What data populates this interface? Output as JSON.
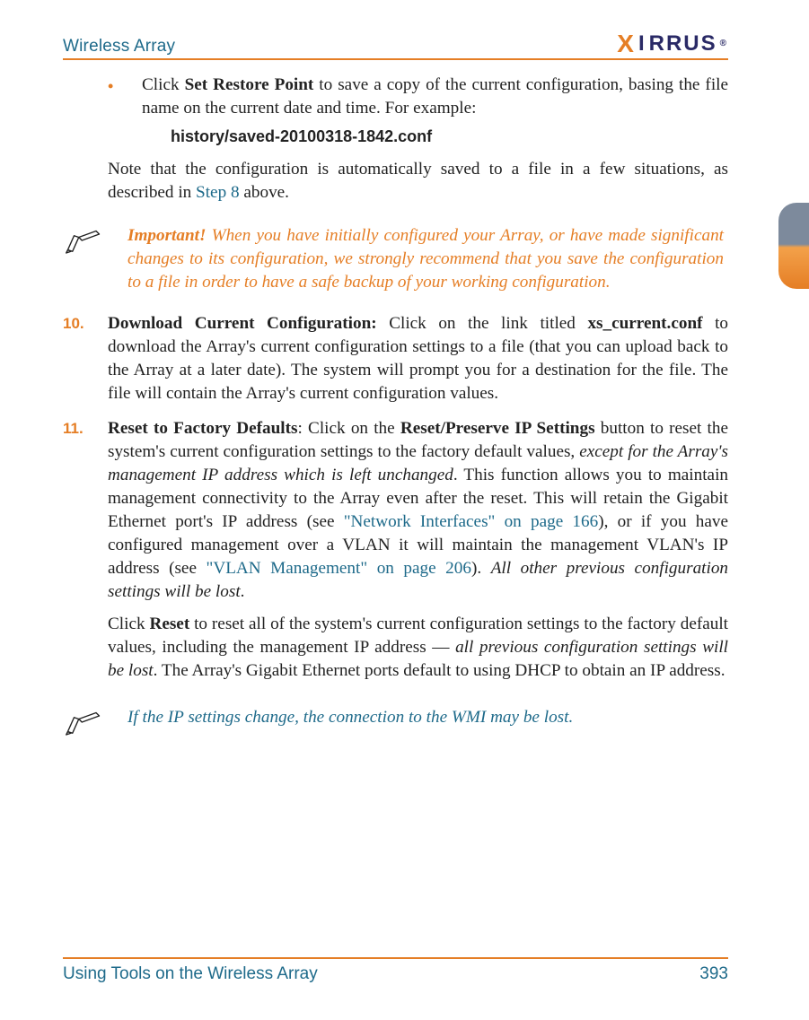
{
  "header": {
    "title": "Wireless Array",
    "logo_left": "X",
    "logo_mid": "I",
    "logo_right": "RRUS",
    "logo_mark": "®"
  },
  "content": {
    "bullet": {
      "lead_a": "Click ",
      "bold_a": "Set Restore Point",
      "tail_a": " to save a copy of the current configuration, basing the file name on the current date and time. For example:"
    },
    "example_filename": "history/saved-20100318-1842.conf",
    "note": {
      "a": "Note that the configuration is automatically saved to a file in a few situations, as described in ",
      "link": "Step 8",
      "b": " above."
    },
    "callout1": {
      "lead": "Important!",
      "body": " When you have initially configured your Array, or have made significant changes to its configuration, we strongly recommend that you save the configuration to a file in order to have a safe backup of your working configuration."
    },
    "item10": {
      "num": "10.",
      "title": "Download Current Configuration:",
      "a": " Click on the link titled ",
      "bold_a": "xs_current.conf",
      "b": " to download the Array's current configuration settings to a file (that you can upload back to the Array at a later date). The system will prompt you for a destination for the file. The file will contain the Array's current configuration values."
    },
    "item11": {
      "num": "11.",
      "title": "Reset to Factory Defaults",
      "a": ": Click on the ",
      "bold_a": "Reset/Preserve IP Settings",
      "b": " button to reset the system's current configuration settings to the factory default values, ",
      "italic_a": "except for the Array's management IP address which is left unchanged",
      "c": ". This function allows you to maintain management connectivity to the Array even after the reset. This will retain the Gigabit Ethernet port's IP address (see ",
      "link_a": "\"Network Interfaces\" on page 166",
      "d": "), or if you have configured management over a VLAN it will maintain the management VLAN's IP address (see ",
      "link_b": "\"VLAN Management\" on page 206",
      "e": "). ",
      "italic_b": "All other previous configuration settings will be lost",
      "f": ".",
      "p2_a": "Click ",
      "p2_bold": "Reset",
      "p2_b": " to reset all of the system's current configuration settings to the factory default values, including the management IP address — ",
      "p2_italic": "all previous configuration settings will be lost",
      "p2_c": ". The Array's Gigabit Ethernet ports default to using DHCP to obtain an IP address."
    },
    "callout2": {
      "body": "If the IP settings change, the connection to the WMI may be lost."
    }
  },
  "footer": {
    "left": "Using Tools on the Wireless Array",
    "right": "393"
  }
}
